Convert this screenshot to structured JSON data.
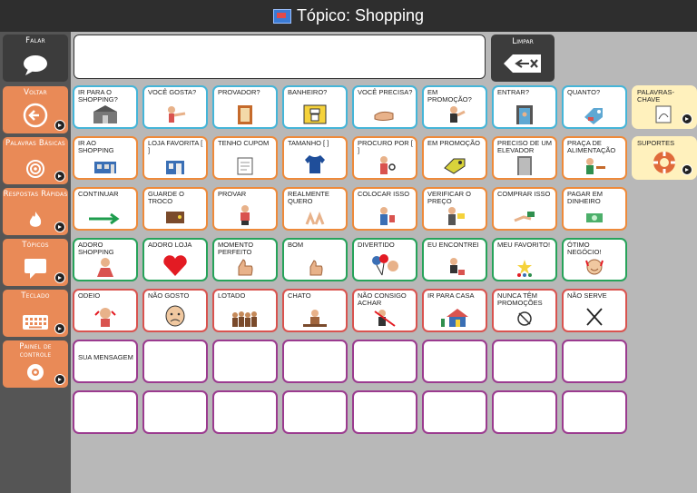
{
  "header": {
    "title": "Tópico: Shopping"
  },
  "top": {
    "falar": "Falar",
    "limpar": "Limpar"
  },
  "sidebar": [
    {
      "label": "Voltar"
    },
    {
      "label": "Palavras Básicas"
    },
    {
      "label": "Respostas Rápidas"
    },
    {
      "label": "Tópicos"
    },
    {
      "label": "Teclado"
    },
    {
      "label": "Painel de controle"
    }
  ],
  "rows": [
    [
      "Ir para o shopping?",
      "Você gosta?",
      "Provador?",
      "Banheiro?",
      "Você precisa?",
      "Em promoção?",
      "Entrar?",
      "Quanto?",
      "Palavras-chave"
    ],
    [
      "Ir ao shopping",
      "Loja favorita [ ]",
      "Tenho cupom",
      "Tamanho [ ]",
      "Procuro por [ ]",
      "Em promoção",
      "Preciso de um elevador",
      "Praça de alimentação",
      "Suportes"
    ],
    [
      "Continuar",
      "Guarde o troco",
      "Provar",
      "Realmente quero",
      "Colocar isso",
      "Verificar o preço",
      "Comprar isso",
      "Pagar em dinheiro"
    ],
    [
      "Adoro shopping",
      "Adoro loja",
      "Momento perfeito",
      "Bom",
      "Divertido",
      "Eu encontrei",
      "Meu favorito!",
      "Ótimo negócio!"
    ],
    [
      "Odeio",
      "Não gosto",
      "Lotado",
      "Chato",
      "Não consigo achar",
      "Ir para casa",
      "Nunca têm promoções",
      "Não serve"
    ],
    [
      "Sua mensagem",
      "",
      "",
      "",
      "",
      "",
      "",
      ""
    ],
    [
      "",
      "",
      "",
      "",
      "",
      "",
      "",
      ""
    ]
  ],
  "colors": {
    "blue": "#45b5d8",
    "orange": "#ee8a3a",
    "green": "#27a35a",
    "red": "#d9534f",
    "purple": "#9b3b8f",
    "yellow": "#fff1bd",
    "sidebar_orange": "#e98a57"
  }
}
